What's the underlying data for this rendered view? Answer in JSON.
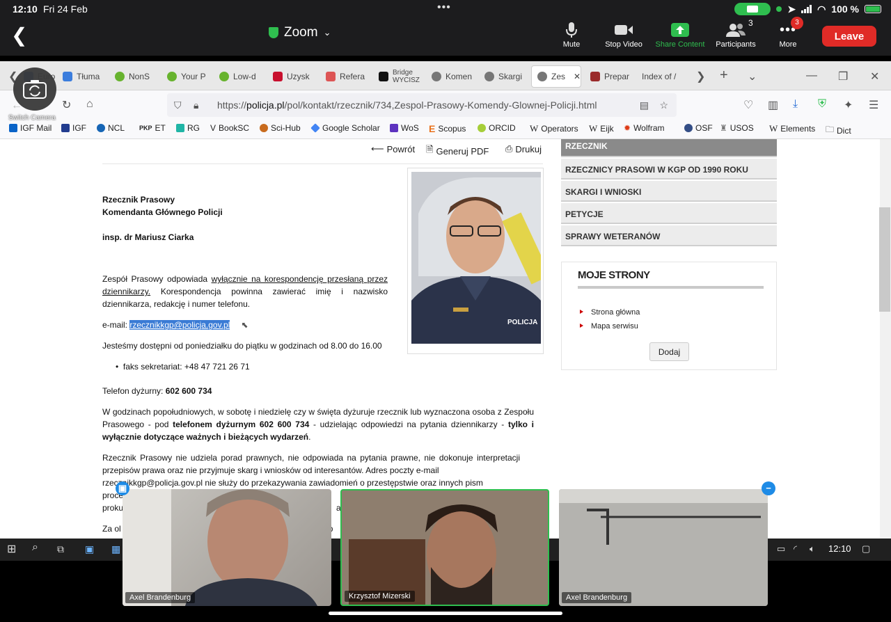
{
  "status": {
    "time": "12:10",
    "date": "Fri 24 Feb",
    "battery": "100 %"
  },
  "zoom": {
    "title": "Zoom",
    "buttons": [
      {
        "label": "Mute"
      },
      {
        "label": "Stop Video"
      },
      {
        "label": "Share Content"
      },
      {
        "label": "Participants",
        "count": "3"
      },
      {
        "label": "More",
        "badge": "3"
      }
    ],
    "leave": "Leave",
    "switch_camera": "Switch Camera"
  },
  "tabs": [
    "Europ",
    "Tłuma",
    "NonS",
    "Your P",
    "Low-d",
    "Uzysk",
    "Refera",
    "Bridge WYCISZ",
    "Komen",
    "Skargi",
    "Zes",
    "Prepar",
    "Index of /"
  ],
  "url": {
    "prefix": "https://",
    "domain": "policja.pl",
    "path": "/pol/kontakt/rzecznik/734,Zespol-Prasowy-Komendy-Glownej-Policji.html"
  },
  "bookmarks": [
    "IGF Mail",
    "IGF",
    "NCL",
    "ET",
    "RG",
    "BookSC",
    "Sci-Hub",
    "Google Scholar",
    "WoS",
    "Scopus",
    "ORCID",
    "Operators",
    "Eijk",
    "Wolfram",
    "OSF",
    "USOS",
    "Elements",
    "Dict"
  ],
  "colors": {
    "zoom_green": "#2fbe4f",
    "leave_red": "#e02b27",
    "selection": "#3a7bd5"
  },
  "page": {
    "tools": {
      "back": "Powrót",
      "pdf": "Generuj PDF",
      "print": "Drukuj"
    },
    "heading1": "Rzecznik Prasowy",
    "heading2": "Komendanta Głównego Policji",
    "name": "insp. dr Mariusz Ciarka",
    "p1_a": "Zespół Prasowy odpowiada ",
    "p1_link": "wyłącznie na korespondencję przesłaną przez dziennikarzy.",
    "p1_b": " Korespondencja powinna zawierać imię i nazwisko dziennikarza, redakcję i numer telefonu.",
    "email_label": "e-mail: ",
    "email": "rzecznikkgp@policja.gov.pl",
    "hours": "Jesteśmy dostępni od poniedziałku do piątku w godzinach od 8.00 do 16.00",
    "fax": "faks sekretariat: +48 47 721 26 71",
    "phone_label": "Telefon dyżurny: ",
    "phone": "602 600 734",
    "p2_a": "W godzinach popołudniowych, w sobotę i niedzielę czy w święta dyżuruje rzecznik lub wyznaczona osoba z Zespołu Prasowego - pod ",
    "p2_b": "telefonem dyżurnym 602 600 734",
    "p2_c": " - udzielając odpowiedzi na pytania dziennikarzy - ",
    "p2_d": "tylko i wyłącznie dotyczące ważnych i bieżących wydarzeń",
    "p3_a": "Rzecznik Prasowy nie udziela porad prawnych, nie odpowiada na pytania prawne, nie dokonuje interpretacji przepisów prawa oraz nie przyjmuje skarg i wniosków od interesantów. Adres poczty e-mail",
    "p3_b": "rzecznikkgp@policja.gov.pl nie służy do przekazywania zawiadomień o przestępstwie oraz innych pism",
    "p3_c": "proce",
    "p3_d": "na",
    "p3_e": "proku",
    "p3_f": "a",
    "p4": "Za ol",
    "p4_b": "sp",
    "photo_badge": "POLICJA"
  },
  "sidebar": {
    "menu": [
      "RZECZNIK",
      "RZECZNICY PRASOWI W KGP OD 1990 ROKU",
      "SKARGI I WNIOSKI",
      "PETYCJE",
      "SPRAWY WETERANÓW"
    ],
    "moje_title": "MOJE STRONY",
    "links": [
      "Strona główna",
      "Mapa serwisu"
    ],
    "add": "Dodaj"
  },
  "taskbar": {
    "time": "12:10"
  },
  "videos": [
    "Axel Brandenburg",
    "Krzysztof Mizerski",
    "Axel Brandenburg"
  ]
}
